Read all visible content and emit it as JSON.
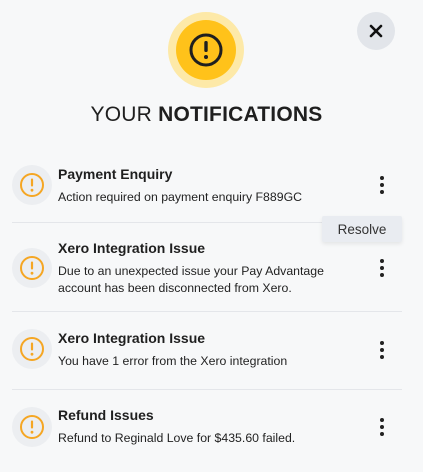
{
  "header": {
    "title_normal": "YOUR",
    "title_bold": "NOTIFICATIONS",
    "alert_icon": "exclamation-circle-icon",
    "close_icon": "close-icon"
  },
  "colors": {
    "accent": "#ffc21a",
    "accent_light": "#fde9a8",
    "item_icon": "#f5a623",
    "close_bg": "#e2e5ea"
  },
  "notifications": [
    {
      "title": "Payment Enquiry",
      "body": "Action required on payment enquiry F889GC",
      "icon": "exclamation-circle-icon"
    },
    {
      "title": "Xero Integration Issue",
      "body": "Due to an unexpected issue your Pay Advantage account has been disconnected from Xero.",
      "icon": "exclamation-circle-icon"
    },
    {
      "title": "Xero Integration Issue",
      "body": "You have 1 error from the Xero integration",
      "icon": "exclamation-circle-icon"
    },
    {
      "title": "Refund Issues",
      "body": "Refund to Reginald Love for $435.60 failed.",
      "icon": "exclamation-circle-icon"
    }
  ],
  "context_menu": {
    "resolve_label": "Resolve"
  }
}
